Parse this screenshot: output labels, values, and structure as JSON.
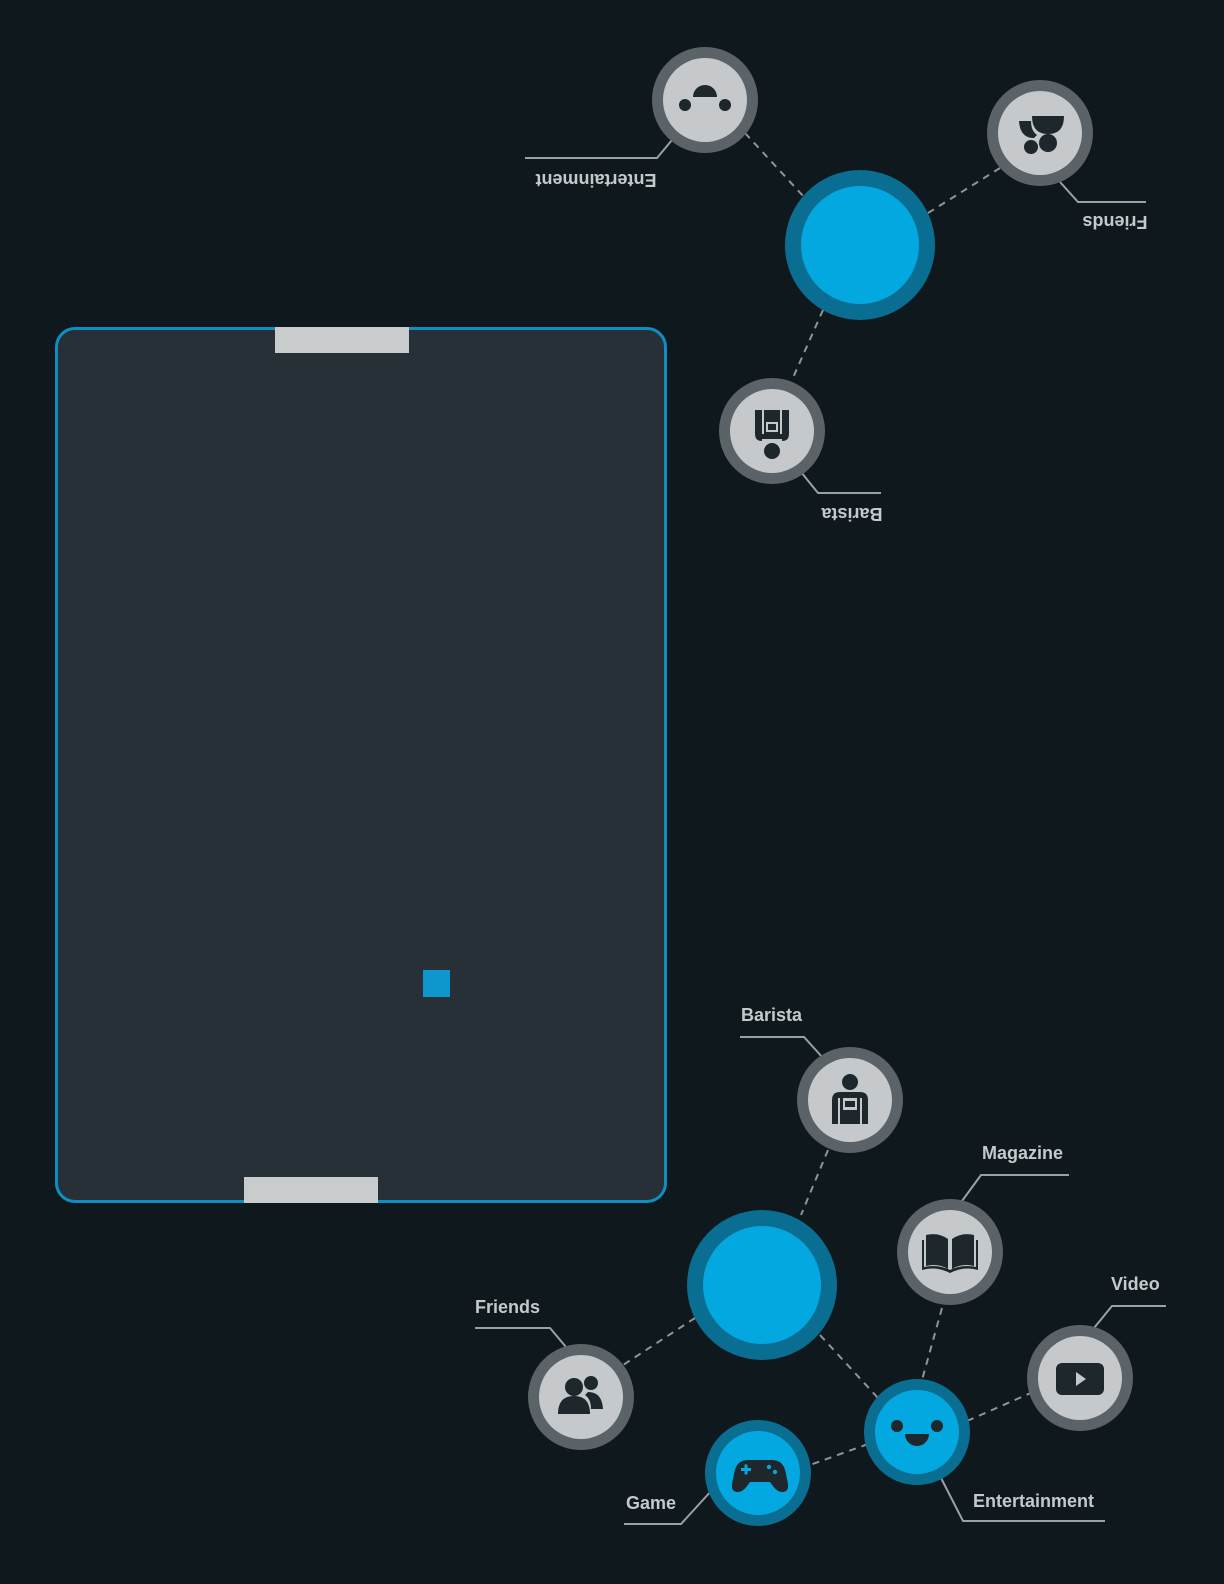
{
  "game": {
    "title": "",
    "board": {
      "border_color": "#0c8fc4",
      "fill": "#263036"
    },
    "paddles": [
      {
        "name": "top-paddle",
        "color": "#c9cccd"
      },
      {
        "name": "bottom-paddle",
        "color": "#c9cccd"
      }
    ],
    "ball": {
      "color": "#0e97cc"
    }
  },
  "menu_opponent": {
    "orientation": "rotated-180",
    "items": [
      {
        "label": "Entertainment",
        "icon": "smiley-face-icon"
      },
      {
        "label": "Friends",
        "icon": "friends-icon"
      },
      {
        "label": "Barista",
        "icon": "barista-icon"
      }
    ]
  },
  "menu_player": {
    "items": [
      {
        "label": "Barista",
        "icon": "barista-icon"
      },
      {
        "label": "Magazine",
        "icon": "open-book-icon"
      },
      {
        "label": "Video",
        "icon": "play-video-icon"
      },
      {
        "label": "Friends",
        "icon": "friends-icon"
      },
      {
        "label": "Game",
        "icon": "gamepad-icon",
        "active": true
      },
      {
        "label": "Entertainment",
        "icon": "smiley-face-icon",
        "active": true
      }
    ]
  },
  "colors": {
    "background": "#0e181d",
    "accent_blue": "#04a8e0",
    "accent_ring": "#0a6e92",
    "node_fill": "#c5c9cb",
    "node_ring": "#5b6368",
    "icon_dark": "#1e272c"
  }
}
